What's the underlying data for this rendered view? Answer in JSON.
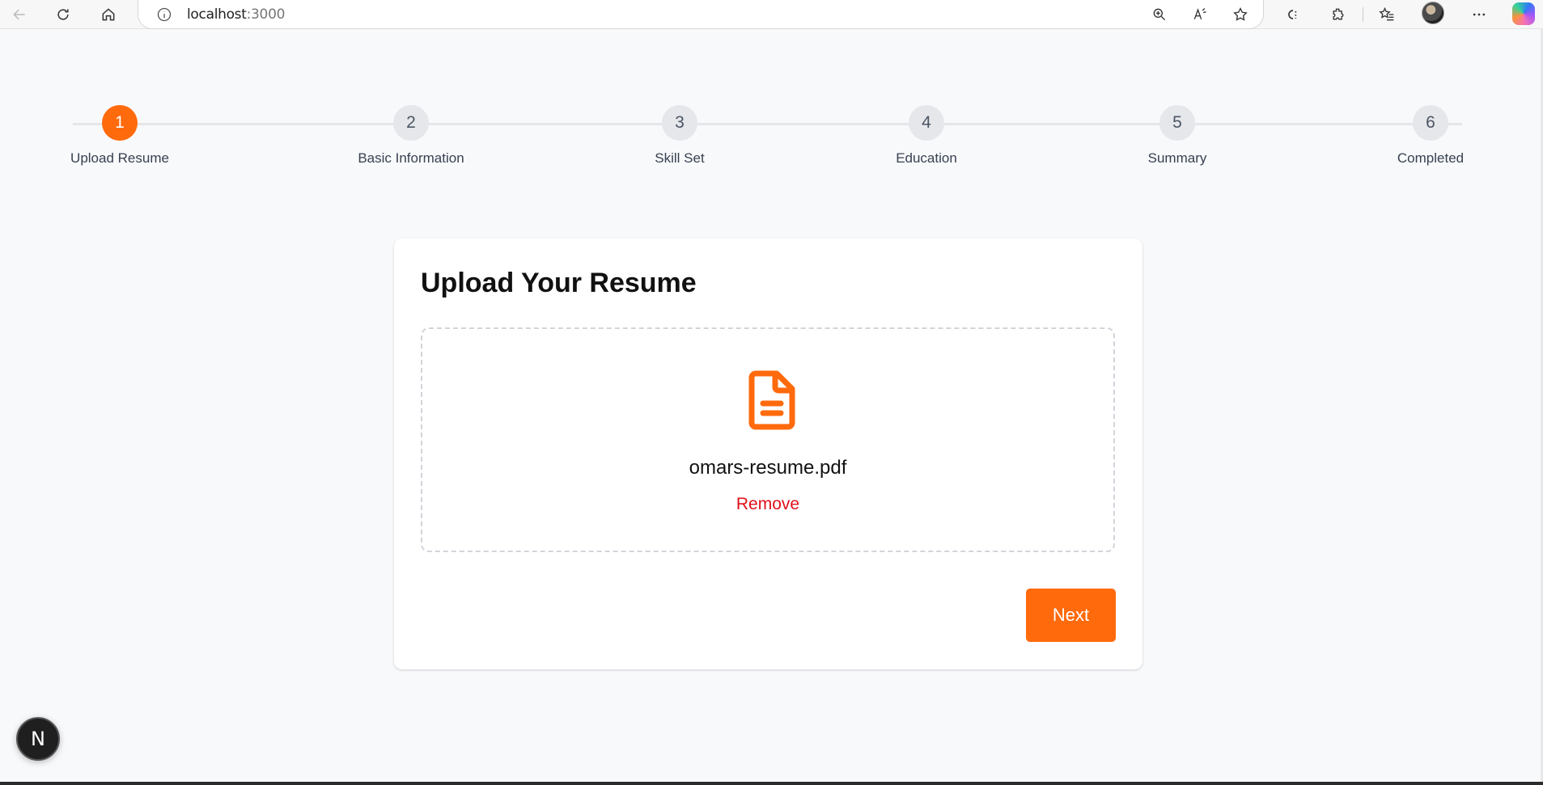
{
  "browser": {
    "url_host": "localhost",
    "url_port": ":3000",
    "icons": [
      "back-icon",
      "refresh-icon",
      "home-icon",
      "info-icon",
      "zoom-icon",
      "read-aloud-icon",
      "favorite-star-icon",
      "collections-icon",
      "extensions-icon",
      "favorites-icon",
      "profile-avatar",
      "more-icon",
      "copilot-icon"
    ]
  },
  "stepper": {
    "steps": [
      {
        "number": "1",
        "label": "Upload Resume",
        "active": true
      },
      {
        "number": "2",
        "label": "Basic Information",
        "active": false
      },
      {
        "number": "3",
        "label": "Skill Set",
        "active": false
      },
      {
        "number": "4",
        "label": "Education",
        "active": false
      },
      {
        "number": "5",
        "label": "Summary",
        "active": false
      },
      {
        "number": "6",
        "label": "Completed",
        "active": false
      }
    ]
  },
  "card": {
    "title": "Upload Your Resume",
    "file_name": "omars-resume.pdf",
    "remove_label": "Remove",
    "next_label": "Next"
  },
  "dev_badge": {
    "letter": "N"
  },
  "colors": {
    "accent": "#ff6a0d",
    "danger": "#e0101a",
    "step_inactive": "#e6e7eb"
  }
}
